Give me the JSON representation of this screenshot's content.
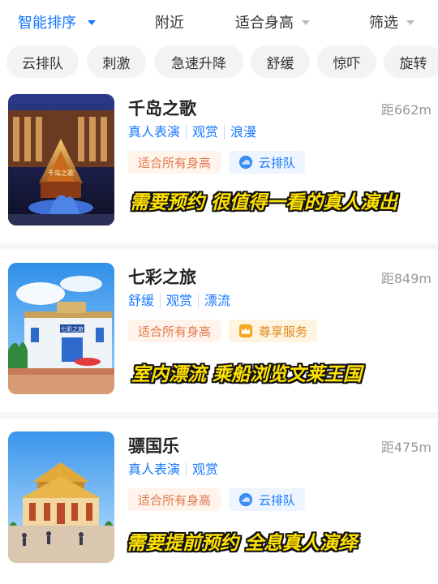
{
  "sort_bar": {
    "items": [
      {
        "label": "智能排序",
        "active": true
      },
      {
        "label": "附近",
        "active": false
      },
      {
        "label": "适合身高",
        "active": false
      },
      {
        "label": "筛选",
        "active": false
      }
    ]
  },
  "chips": [
    "云排队",
    "刺激",
    "急速升降",
    "舒缓",
    "惊吓",
    "旋转"
  ],
  "attractions": [
    {
      "title": "千岛之歌",
      "distance": "距662m",
      "tags": [
        "真人表演",
        "观赏",
        "浪漫"
      ],
      "height_badge": "适合所有身高",
      "service_badge": "云排队",
      "service_icon": "cloud-icon",
      "caption": "需要预约 很值得一看的真人演出",
      "thumb_sign": "千岛之歌"
    },
    {
      "title": "七彩之旅",
      "distance": "距849m",
      "tags": [
        "舒缓",
        "观赏",
        "漂流"
      ],
      "height_badge": "适合所有身高",
      "service_badge": "尊享服务",
      "service_icon": "crown-icon",
      "caption": "室内漂流 乘船浏览文莱王国",
      "thumb_sign": "七彩之旅"
    },
    {
      "title": "骠国乐",
      "distance": "距475m",
      "tags": [
        "真人表演",
        "观赏"
      ],
      "height_badge": "适合所有身高",
      "service_badge": "云排队",
      "service_icon": "cloud-icon",
      "caption": "需要提前预约 全息真人演绎"
    }
  ],
  "colors": {
    "accent": "#1677ff",
    "caption": "#ffe100",
    "height_badge": "#e07a4a",
    "vip": "#e08a1a"
  }
}
